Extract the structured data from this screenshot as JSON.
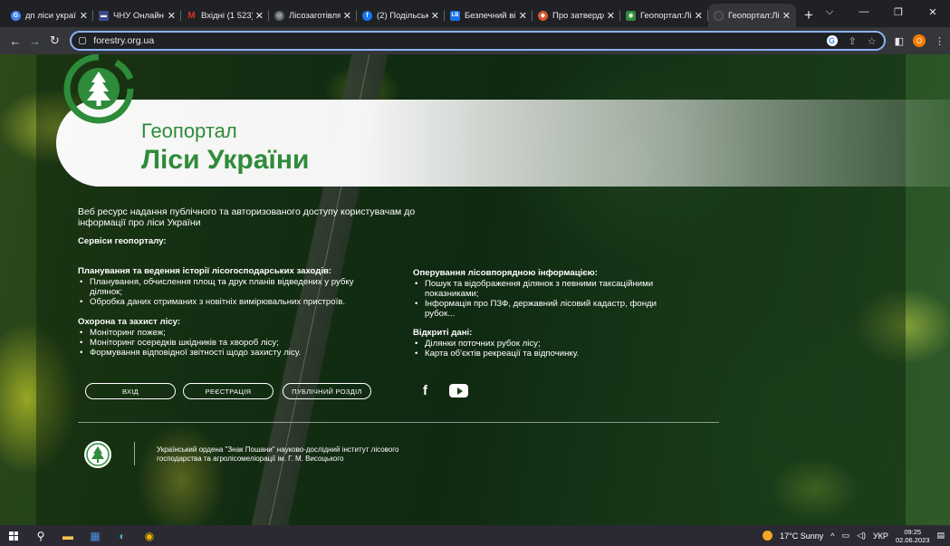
{
  "browser": {
    "tabs": [
      {
        "title": "дп ліси украї",
        "fav_color": "#4285f4",
        "fav_glyph": "G"
      },
      {
        "title": "ЧНУ Онлайн",
        "fav_color": "#3c4a8a",
        "fav_glyph": "▬"
      },
      {
        "title": "Вхідні (1 523)",
        "fav_color": "#d93025",
        "fav_glyph": "M"
      },
      {
        "title": "Лісозаготівля",
        "fav_color": "#5f6368",
        "fav_glyph": "◎"
      },
      {
        "title": "(2) Подільськ",
        "fav_color": "#1877f2",
        "fav_glyph": "f"
      },
      {
        "title": "Безпечний ві",
        "fav_color": "#1a73e8",
        "fav_glyph": "LB"
      },
      {
        "title": "Про затвердж",
        "fav_color": "#d6562b",
        "fav_glyph": "◆"
      },
      {
        "title": "Геопортал:Лі",
        "fav_color": "#2e8b3a",
        "fav_glyph": "◉"
      },
      {
        "title": "Геопортал:Лі",
        "fav_color": "#3a3b3f",
        "fav_glyph": "○",
        "active": true
      }
    ],
    "new_tab": "+",
    "url": "forestry.org.ua",
    "profile_initial": "О"
  },
  "page": {
    "logo": {
      "line1": "Геопортал",
      "line2": "Ліси України"
    },
    "intro": "Веб ресурс надання публічного та авторизованого доступу користувачам до інформації про ліси України",
    "services_title": "Сервіси геопорталу:",
    "sections": [
      {
        "title": "Планування та ведення історії лісогосподарських заходів:",
        "items": [
          "Планування, обчислення площ та друк планів відведених у рубку ділянок;",
          "Обробка даних отриманих з новітніх вимірювальних пристроїв."
        ]
      },
      {
        "title": "Охорона та захист лісу:",
        "items": [
          "Моніторинг пожеж;",
          "Моніторинг осередків шкідників та хвороб лісу;",
          "Формування відповідної звітності щодо захисту лісу."
        ]
      },
      {
        "title": "Оперування лісовпорядною інформацією:",
        "items": [
          "Пошук та відображення ділянок з певними таксаційними показниками;",
          "Інформація про ПЗФ, державний лісовий кадастр, фонди рубок..."
        ]
      },
      {
        "title": "Відкриті дані:",
        "items": [
          "Ділянки поточних рубок лісу;",
          "Карта об'єктів рекреації та відпочинку."
        ]
      }
    ],
    "buttons": {
      "login": "ВХІД",
      "register": "РЕЄСТРАЦІЯ",
      "public": "ПУБЛІЧНИЙ РОЗДІЛ"
    },
    "institute": "Український ордена \"Знак Пошани\" науково-дослідний інститут лісового господарства та агролісомеліорації ім. Г. М. Висоцького"
  },
  "taskbar": {
    "weather": "17°C  Sunny",
    "language": "УКР",
    "time": "09:25",
    "date": "02.06.2023"
  },
  "colors": {
    "brand_green": "#2e8b3a",
    "omnibox_border": "#8ab4f8"
  }
}
